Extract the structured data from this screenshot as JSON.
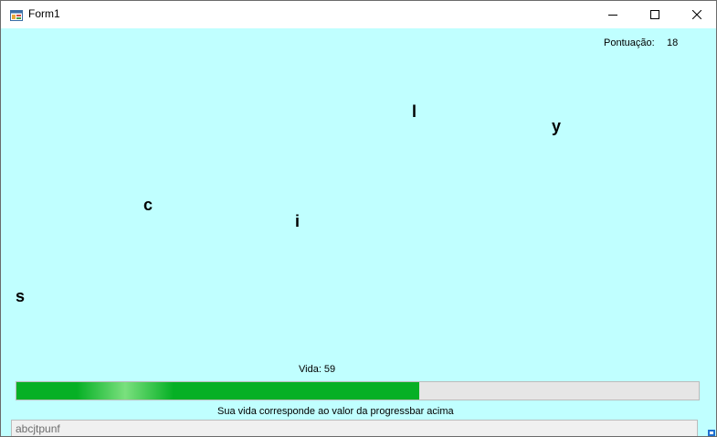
{
  "window": {
    "title": "Form1",
    "controls": {
      "minimize_icon": "minimize-icon",
      "maximize_icon": "maximize-icon",
      "close_icon": "close-icon"
    }
  },
  "score": {
    "label": "Pontuação:",
    "value": "18"
  },
  "letters": [
    "l",
    "y",
    "c",
    "i",
    "s"
  ],
  "life": {
    "label": "Vida: 59",
    "value": 59,
    "max": 100,
    "hint": "Sua vida corresponde ao valor da progressbar acima"
  },
  "input": {
    "value": "abcjtpunf"
  },
  "colors": {
    "background": "#c0ffff",
    "progress_fill": "#06b025",
    "progress_track": "#e6e6e6"
  }
}
